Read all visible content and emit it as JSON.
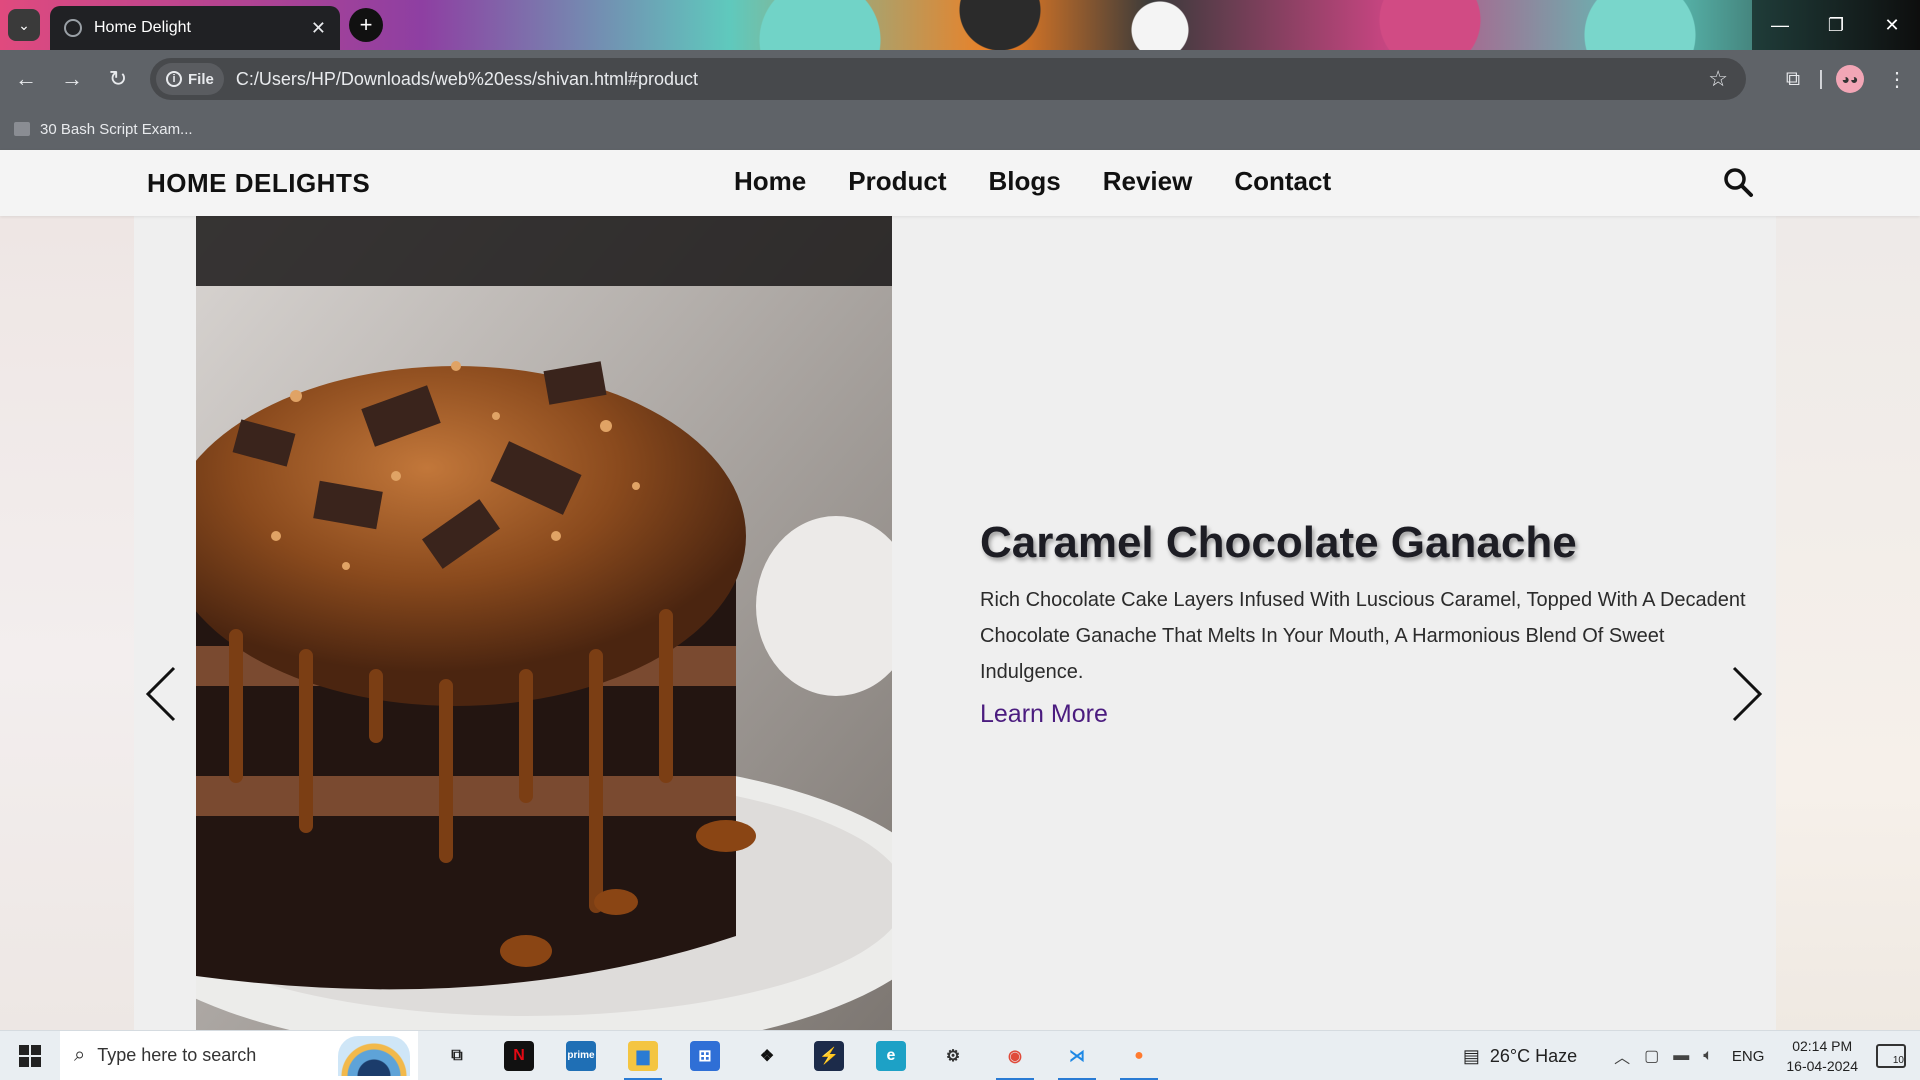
{
  "browser": {
    "tab_title": "Home Delight",
    "tab_close": "✕",
    "new_tab": "+",
    "url_chip": "File",
    "url": "C:/Users/HP/Downloads/web%20ess/shivan.html#product",
    "bookmark": "30 Bash Script Exam...",
    "controls": {
      "minimize": "—",
      "restore": "❐",
      "close": "✕"
    }
  },
  "site": {
    "logo": "HOME DELIGHTS",
    "nav": [
      "Home",
      "Product",
      "Blogs",
      "Review",
      "Contact"
    ],
    "slide": {
      "title": "Caramel Chocolate Ganache",
      "description": "Rich Chocolate Cake Layers Infused With Luscious Caramel, Topped With A Decadent Chocolate Ganache That Melts In Your Mouth, A Harmonious Blend Of Sweet Indulgence.",
      "cta": "Learn More"
    }
  },
  "taskbar": {
    "search_placeholder": "Type here to search",
    "apps": [
      {
        "name": "task-view-icon",
        "label": "⧉",
        "color": "#e9eef2",
        "fg": "#222"
      },
      {
        "name": "netflix-icon",
        "label": "N",
        "color": "#111",
        "fg": "#e50914"
      },
      {
        "name": "prime-video-icon",
        "label": "prime",
        "color": "#1f6fb5",
        "fg": "#fff"
      },
      {
        "name": "file-explorer-icon",
        "label": "▆",
        "color": "#f4c542",
        "fg": "#2a7bd4"
      },
      {
        "name": "microsoft-store-icon",
        "label": "⊞",
        "color": "#2f6fd6",
        "fg": "#fff"
      },
      {
        "name": "dropbox-icon",
        "label": "❖",
        "color": "#e9eef2",
        "fg": "#111"
      },
      {
        "name": "powershell-icon",
        "label": "⚡",
        "color": "#1c2b4a",
        "fg": "#5fb0ff"
      },
      {
        "name": "edge-icon",
        "label": "e",
        "color": "#1da1c6",
        "fg": "#fff"
      },
      {
        "name": "settings-icon",
        "label": "⚙",
        "color": "#e9eef2",
        "fg": "#333"
      },
      {
        "name": "chrome-icon",
        "label": "◉",
        "color": "#e9eef2",
        "fg": "#e04a3a"
      },
      {
        "name": "vscode-icon",
        "label": "⋊",
        "color": "#e9eef2",
        "fg": "#1e88e5"
      },
      {
        "name": "firefox-icon",
        "label": "●",
        "color": "#e9eef2",
        "fg": "#ff7a2f"
      }
    ],
    "weather": "26°C  Haze",
    "language": "ENG",
    "time": "02:14 PM",
    "date": "16-04-2024",
    "notifications": "10"
  }
}
